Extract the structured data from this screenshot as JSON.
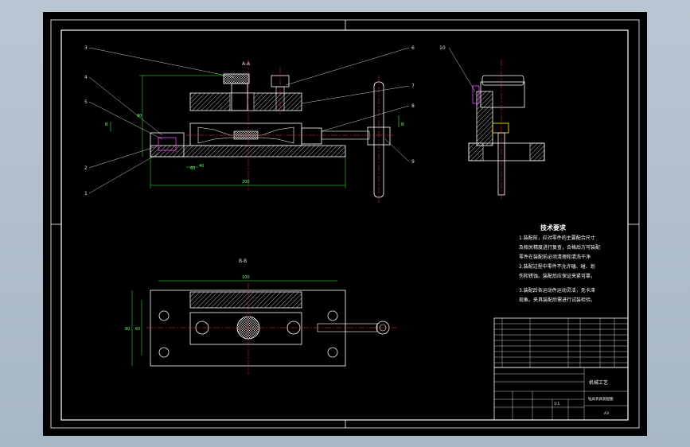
{
  "sections": {
    "section_aa": "A-A",
    "section_bb": "B-B",
    "arrow_b_left": "B",
    "arrow_b_right": "B"
  },
  "dimensions": {
    "width_main": "200",
    "width_top": "100",
    "height_left": "80",
    "height_left2": "60",
    "height_front": "80",
    "small_dim": "60",
    "small_dim2": "40"
  },
  "part_numbers": {
    "p1": "1",
    "p2": "2",
    "p3": "3",
    "p4": "4",
    "p5": "5",
    "p6": "6",
    "p7": "7",
    "p8": "8",
    "p9": "9",
    "p10": "10",
    "p11": "1"
  },
  "tech_requirements": {
    "title": "技术要求",
    "lines": [
      "1.装配前，应对零件的主要配合尺寸",
      "及相关精度进行复查，合格后方可装配",
      "零件在装配前必须清理和清洗干净",
      "2.装配过程中零件不允许磕、碰、划",
      "伤和锈蚀。装配后应保证夹紧可靠，",
      "3.装配后各运动件运动灵活，无卡滞",
      "现象。夹具装配后需进行试装检验。"
    ]
  },
  "title_block": {
    "title": "机械工艺",
    "subtitle": "钻床夹具装配图",
    "scale": "1:1",
    "sheet": "A3"
  },
  "colors": {
    "background_app": "#b0bfce",
    "canvas": "#000000",
    "border": "#ffffff",
    "dimension": "#33ff33",
    "leader": "#ffffff",
    "centerline": "#ff3333",
    "hatch": "#ffffff",
    "magenta": "#ff44ff",
    "yellow": "#ffff33"
  }
}
